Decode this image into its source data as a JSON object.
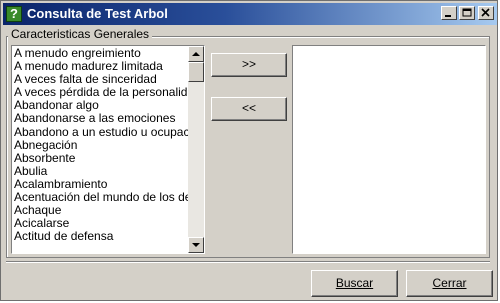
{
  "window": {
    "title": "Consulta de Test Arbol",
    "icon": "question-icon"
  },
  "group": {
    "label": "Caracteristicas Generales"
  },
  "list": {
    "items": [
      "A menudo engreimiento",
      "A menudo madurez limitada",
      "A veces falta de sinceridad",
      "A veces pérdida de la personalidad",
      "Abandonar algo",
      "Abandonarse a las emociones",
      "Abandono a un estudio u ocupación",
      "Abnegación",
      "Absorbente",
      "Abulia",
      "Acalambramiento",
      "Acentuación del mundo de los deseos",
      "Achaque",
      "Acicalarse",
      "Actitud de defensa"
    ]
  },
  "transfer": {
    "add_label": ">>",
    "remove_label": "<<"
  },
  "actions": {
    "search_label": "Buscar",
    "close_label": "Cerrar"
  },
  "colors": {
    "title_start": "#0a246a",
    "title_end": "#a6caf0",
    "face": "#d4d0c8"
  }
}
